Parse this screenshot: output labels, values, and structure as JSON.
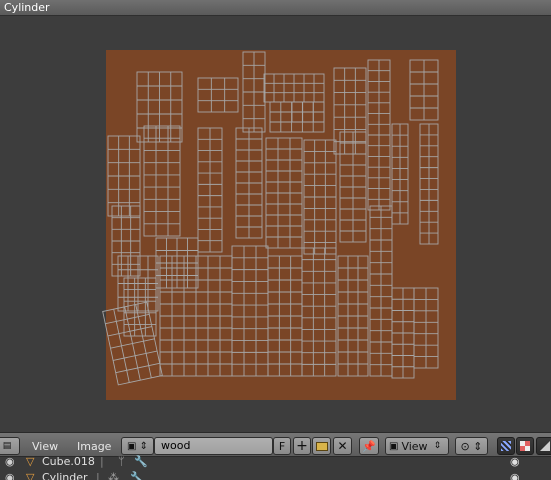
{
  "window": {
    "title": "Cylinder"
  },
  "header": {
    "menus": {
      "view": "View",
      "image": "Image"
    },
    "image_name": "wood",
    "fake_user": "F",
    "view_select": "View"
  },
  "outliner": {
    "rows": [
      {
        "label": "Cube.018"
      },
      {
        "label": "Cylinder"
      }
    ]
  },
  "colors": {
    "texture": "#7a4526",
    "uv_wire": "#a4a4a4",
    "viewport_bg": "#3d3d3d"
  }
}
